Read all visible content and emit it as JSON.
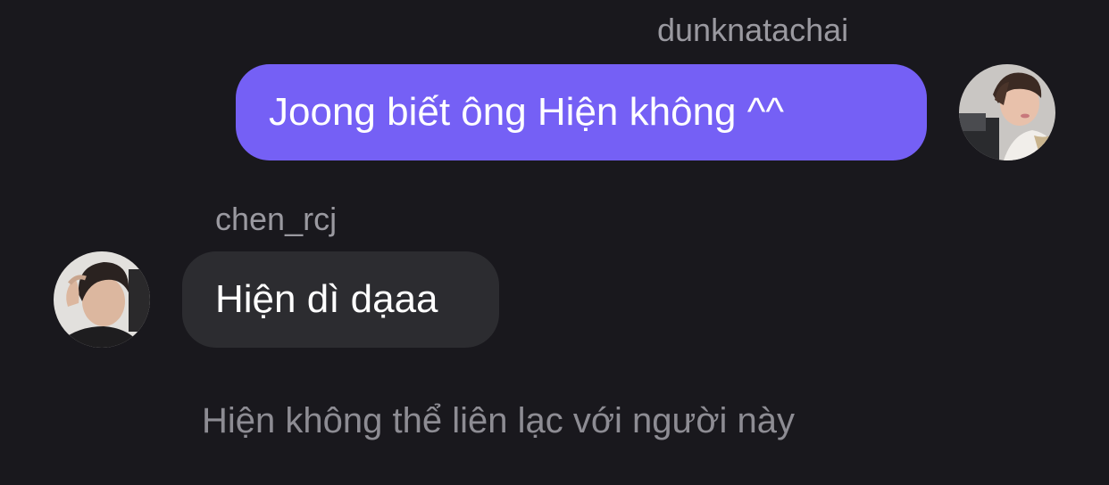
{
  "thread": {
    "messages": [
      {
        "sender": "dunknatachai",
        "text": "Joong biết ông Hiện không ^^",
        "direction": "outgoing",
        "bubble_color": "#7560f5"
      },
      {
        "sender": "chen_rcj",
        "text": "Hiện dì dạaa",
        "direction": "incoming",
        "bubble_color": "#2c2c30"
      }
    ],
    "system_note": "Hiện không thể liên lạc với người này"
  },
  "colors": {
    "background": "#19181d",
    "username_text": "#9a99a0",
    "system_text": "#8d8c93"
  }
}
